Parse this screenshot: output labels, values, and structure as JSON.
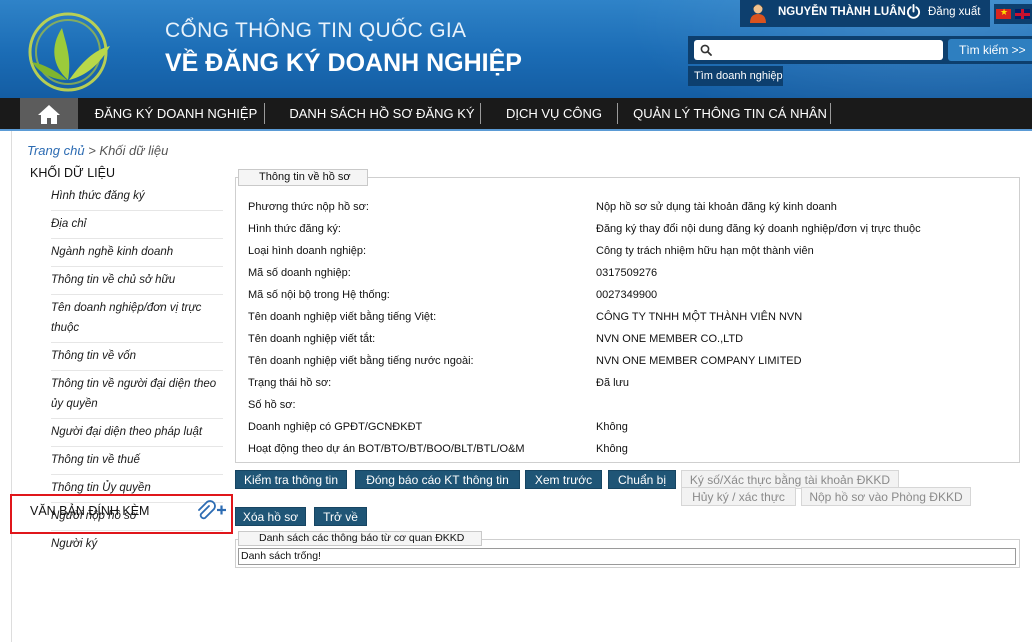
{
  "header": {
    "title_line1": "CỔNG THÔNG TIN QUỐC GIA",
    "title_line2": "VỀ ĐĂNG KÝ DOANH NGHIỆP",
    "user_name": "NGUYỄN THÀNH LUÂN",
    "logout_label": "Đăng xuất",
    "search": {
      "value": "",
      "button_label": "Tìm kiếm >>",
      "tooltip": "Tìm doanh nghiệp"
    }
  },
  "nav": {
    "items": [
      {
        "label": "ĐĂNG KÝ DOANH NGHIỆP"
      },
      {
        "label": "DANH SÁCH HỒ SƠ ĐĂNG KÝ"
      },
      {
        "label": "DỊCH VỤ CÔNG"
      },
      {
        "label": "QUẢN LÝ THÔNG TIN CÁ NHÂN"
      }
    ]
  },
  "breadcrumb": {
    "home": "Trang chủ",
    "separator": " > ",
    "current": "Khối dữ liệu"
  },
  "sidebar": {
    "title": "KHỐI DỮ LIỆU",
    "items": [
      {
        "label": "Hình thức đăng ký"
      },
      {
        "label": "Địa chỉ"
      },
      {
        "label": "Ngành nghề kinh doanh"
      },
      {
        "label": "Thông tin về chủ sở hữu"
      },
      {
        "label": "Tên doanh nghiệp/đơn vị trực thuộc"
      },
      {
        "label": "Thông tin về vốn"
      },
      {
        "label": "Thông tin về người đại diện theo ủy quyền"
      },
      {
        "label": "Người đại diện theo pháp luật"
      },
      {
        "label": "Thông tin về thuế"
      },
      {
        "label": "Thông tin Ủy quyền"
      },
      {
        "label": "Người nộp hồ sơ"
      },
      {
        "label": "Người ký"
      }
    ],
    "attachment_label": "VĂN BẢN ĐÍNH KÈM"
  },
  "info": {
    "legend": "Thông tin về hồ sơ",
    "rows": [
      {
        "label": "Phương thức nộp hồ sơ:",
        "value": "Nộp hồ sơ sử dụng tài khoản đăng ký kinh doanh"
      },
      {
        "label": "Hình thức đăng ký:",
        "value": "Đăng ký thay đổi nội dung đăng ký doanh nghiệp/đơn vị trực thuộc"
      },
      {
        "label": "Loại hình doanh nghiệp:",
        "value": "Công ty trách nhiệm hữu hạn một thành viên"
      },
      {
        "label": "Mã số doanh nghiệp:",
        "value": "0317509276"
      },
      {
        "label": "Mã số nội bộ trong Hệ thống:",
        "value": "0027349900"
      },
      {
        "label": "Tên doanh nghiệp viết bằng tiếng Việt:",
        "value": "CÔNG TY TNHH MỘT THÀNH VIÊN NVN"
      },
      {
        "label": "Tên doanh nghiệp viết tắt:",
        "value": "NVN ONE MEMBER CO.,LTD"
      },
      {
        "label": "Tên doanh nghiệp viết bằng tiếng nước ngoài:",
        "value": "NVN ONE MEMBER COMPANY LIMITED"
      },
      {
        "label": "Trạng thái hồ sơ:",
        "value": "Đã lưu"
      },
      {
        "label": "Số hồ sơ:",
        "value": ""
      },
      {
        "label": "Doanh nghiệp có GPĐT/GCNĐKĐT",
        "value": "Không"
      },
      {
        "label": "Hoạt động theo dự án BOT/BTO/BT/BOO/BLT/BTL/O&M",
        "value": "Không"
      }
    ]
  },
  "actions": {
    "check": "Kiểm tra thông tin",
    "close_report": "Đóng báo cáo KT thông tin",
    "preview": "Xem trước",
    "prepare": "Chuẩn bị",
    "sign": "Ký số/Xác thực bằng tài khoản ĐKKD",
    "cancel_sign": "Hủy ký / xác thực",
    "submit": "Nộp hồ sơ vào Phòng ĐKKD",
    "delete": "Xóa hồ sơ",
    "back": "Trở về"
  },
  "notices": {
    "legend": "Danh sách các thông báo từ cơ quan ĐKKD",
    "empty_text": "Danh sách trống!"
  },
  "colors": {
    "header_blue": "#1b6cb5",
    "navbar": "#1a1a1a",
    "button": "#1f5576",
    "highlight": "#e0161b"
  }
}
